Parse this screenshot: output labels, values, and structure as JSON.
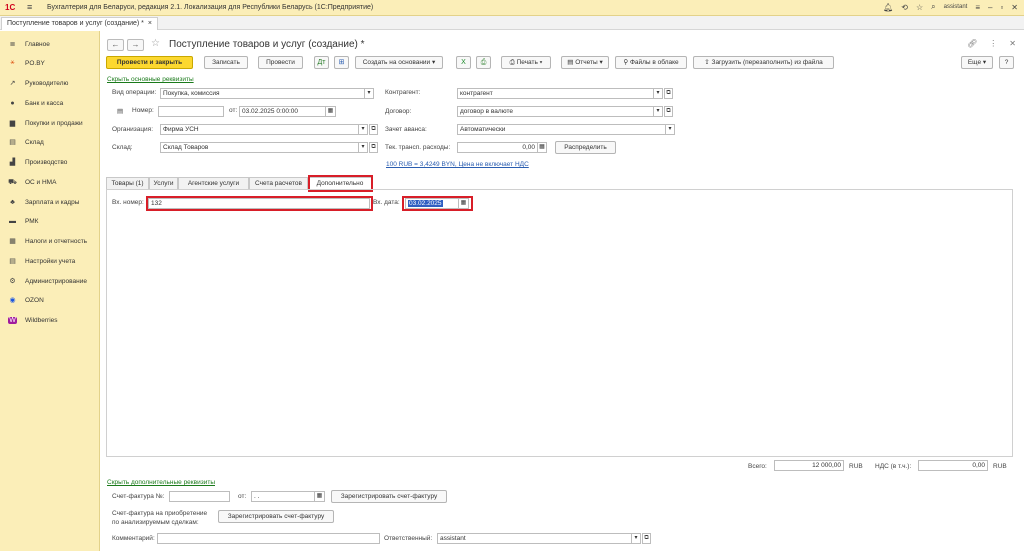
{
  "window": {
    "logo": "1С",
    "title": "Бухгалтерия для Беларуси, редакция 2.1. Локализация для Республики Беларусь  (1С:Предприятие)",
    "user": "assistant"
  },
  "open_tab": {
    "label": "Поступление товаров и услуг (создание) *",
    "close": "×"
  },
  "sidebar": {
    "items": [
      {
        "label": "Главное",
        "icon": "≣"
      },
      {
        "label": "PO.BY",
        "icon": "⚹"
      },
      {
        "label": "Руководителю",
        "icon": "↗"
      },
      {
        "label": "Банк и касса",
        "icon": "●"
      },
      {
        "label": "Покупки и продажи",
        "icon": "▆"
      },
      {
        "label": "Склад",
        "icon": "▤"
      },
      {
        "label": "Производство",
        "icon": "▟"
      },
      {
        "label": "ОС и НМА",
        "icon": "⛟"
      },
      {
        "label": "Зарплата и кадры",
        "icon": "♣"
      },
      {
        "label": "РМК",
        "icon": "▬"
      },
      {
        "label": "Налоги и отчетность",
        "icon": "▦"
      },
      {
        "label": "Настройки учета",
        "icon": "▤"
      },
      {
        "label": "Администрирование",
        "icon": "⚙"
      },
      {
        "label": "OZON",
        "icon": "◉"
      },
      {
        "label": "Wildberries",
        "icon": "W"
      }
    ]
  },
  "doc": {
    "title": "Поступление товаров и услуг (создание) *"
  },
  "toolbar": {
    "post_close": "Провести и закрыть",
    "save": "Записать",
    "post": "Провести",
    "create_based": "Создать на основании",
    "print": "Печать",
    "reports": "Отчеты",
    "files": "Файлы в облаке",
    "load": "Загрузить (перезаполнить) из файла",
    "more": "Еще",
    "help": "?"
  },
  "header": {
    "hide_main": "Скрыть основные реквизиты",
    "op_type_label": "Вид операции:",
    "op_type_value": "Покупка, комиссия",
    "number_label": "Номер:",
    "number_value": "",
    "from_label": "от:",
    "date_value": "03.02.2025  0:00:00",
    "org_label": "Организация:",
    "org_value": "Фирма УСН",
    "warehouse_label": "Склад:",
    "warehouse_value": "Склад Товаров",
    "counterparty_label": "Контрагент:",
    "counterparty_value": "контрагент",
    "contract_label": "Договор:",
    "contract_value": "договор в валюте",
    "advance_label": "Зачет аванса:",
    "advance_value": "Автоматически",
    "transport_label": "Тек. трансп. расходы:",
    "transport_value": "0,00",
    "distribute": "Распределить",
    "rate_link": "100 RUB = 3,4249 BYN, Цена не включает НДС"
  },
  "tabs": [
    {
      "label": "Товары (1)"
    },
    {
      "label": "Услуги"
    },
    {
      "label": "Агентские услуги"
    },
    {
      "label": "Счета расчетов"
    },
    {
      "label": "Дополнительно"
    }
  ],
  "extra": {
    "in_number_label": "Вх. номер:",
    "in_number_value": "132",
    "in_date_label": "Вх. дата:",
    "in_date_value": "03.02.2025"
  },
  "totals": {
    "total_label": "Всего:",
    "total_value": "12 000,00",
    "currency": "RUB",
    "vat_label": "НДС (в т.ч.):",
    "vat_value": "0,00",
    "vat_currency": "RUB"
  },
  "footer": {
    "hide_extra": "Скрыть дополнительные реквизиты",
    "invoice_label": "Счет-фактура №:",
    "invoice_number": "",
    "invoice_from": "от:",
    "invoice_date": " .  .",
    "register_invoice": "Зарегистрировать счет-фактуру",
    "invoice_analyzed_label_1": "Счет-фактура на приобретение",
    "invoice_analyzed_label_2": "по анализируемым сделкам:",
    "register_invoice_2": "Зарегистрировать счет-фактуру",
    "comment_label": "Комментарий:",
    "comment_value": "",
    "responsible_label": "Ответственный:",
    "responsible_value": "assistant"
  }
}
